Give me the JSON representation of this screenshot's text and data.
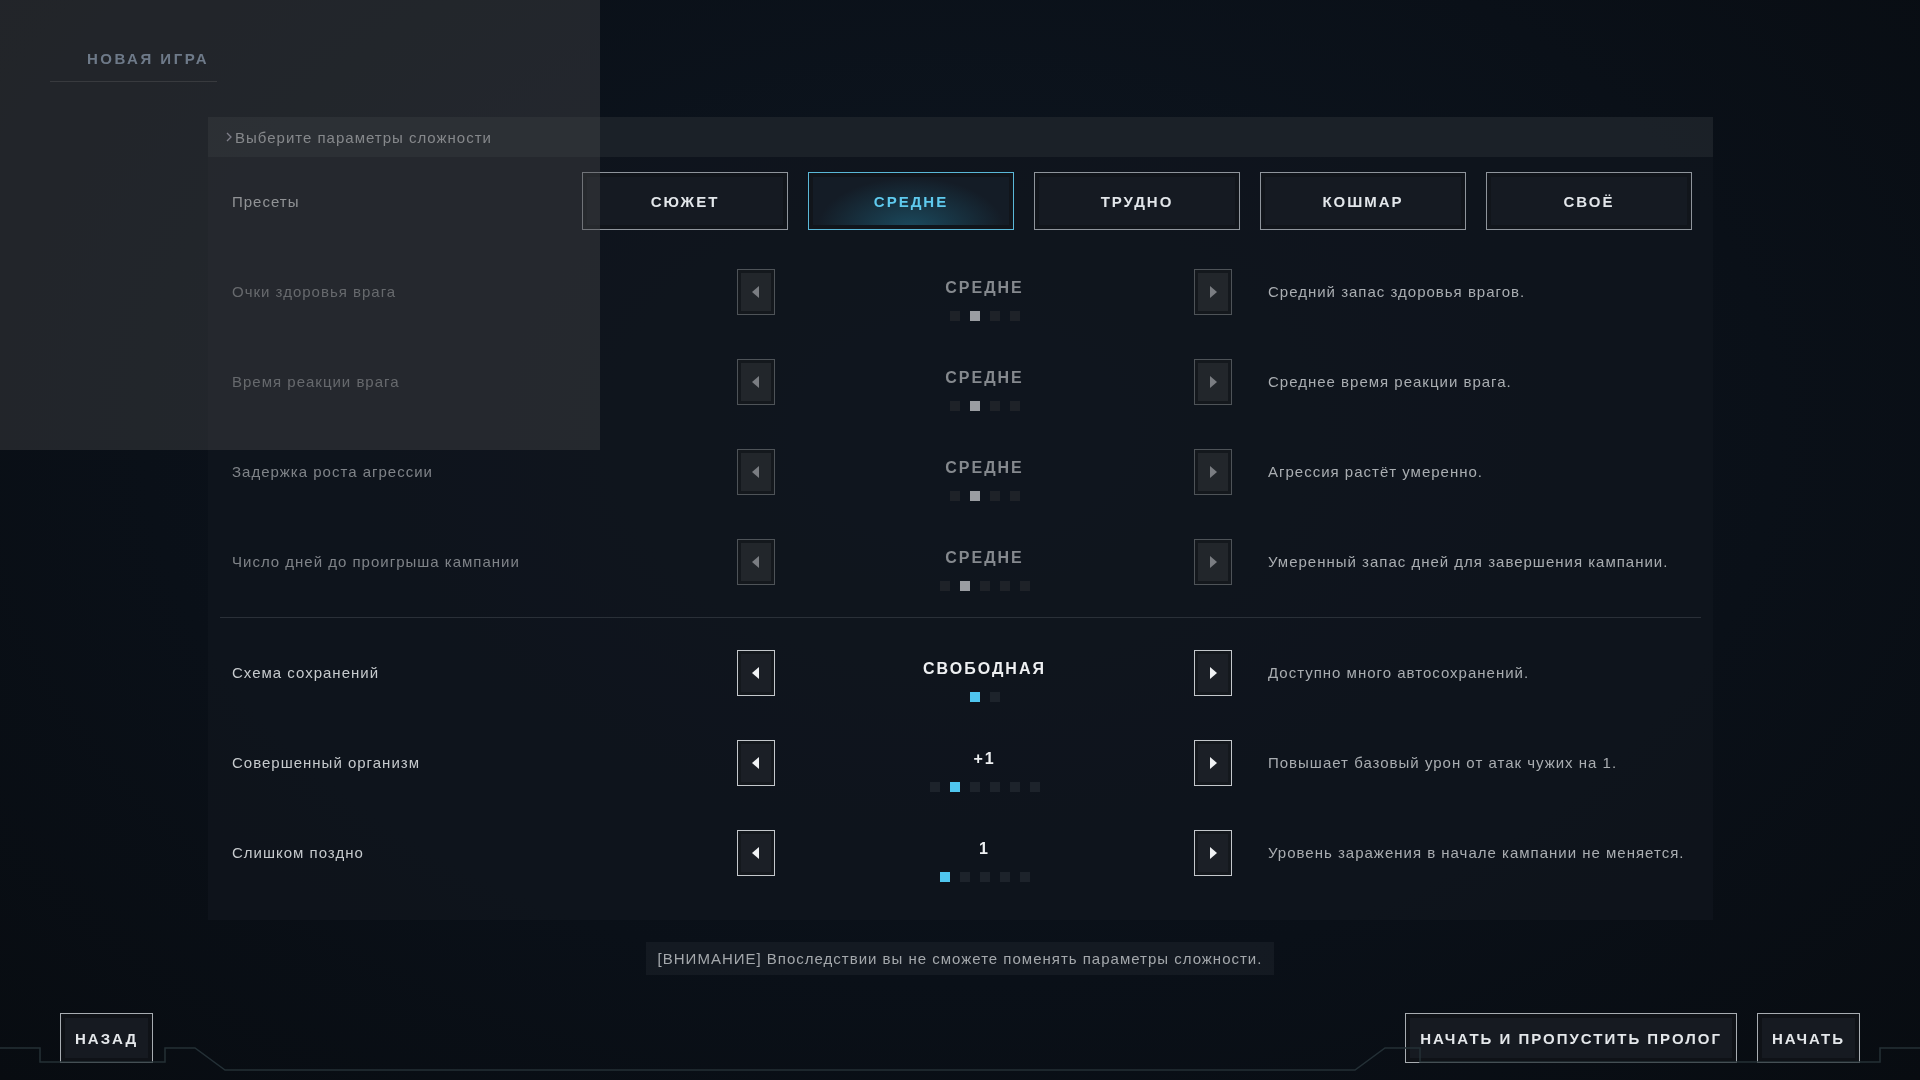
{
  "title": "НОВАЯ ИГРА",
  "section_header": "Выберите параметры сложности",
  "presets": {
    "label": "Пресеты",
    "options": [
      {
        "label": "СЮЖЕТ",
        "selected": false
      },
      {
        "label": "СРЕДНЕ",
        "selected": true
      },
      {
        "label": "ТРУДНО",
        "selected": false
      },
      {
        "label": "КОШМАР",
        "selected": false
      },
      {
        "label": "СВОЁ",
        "selected": false
      }
    ]
  },
  "setting_groups": [
    {
      "settings": [
        {
          "label": "Очки здоровья врага",
          "value": "СРЕДНЕ",
          "description": "Средний запас здоровья врагов.",
          "disabled": true,
          "pips": [
            {
              "selected": false
            },
            {
              "selected": true
            },
            {
              "selected": false
            },
            {
              "selected": false
            }
          ]
        },
        {
          "label": "Время реакции врага",
          "value": "СРЕДНЕ",
          "description": "Среднее время реакции врага.",
          "disabled": true,
          "pips": [
            {
              "selected": false
            },
            {
              "selected": true
            },
            {
              "selected": false
            },
            {
              "selected": false
            }
          ]
        },
        {
          "label": "Задержка роста агрессии",
          "value": "СРЕДНЕ",
          "description": "Агрессия растёт умеренно.",
          "disabled": true,
          "pips": [
            {
              "selected": false
            },
            {
              "selected": true
            },
            {
              "selected": false
            },
            {
              "selected": false
            }
          ]
        },
        {
          "label": "Число дней до проигрыша кампании",
          "value": "СРЕДНЕ",
          "description": "Умеренный запас дней для завершения кампании.",
          "disabled": true,
          "pips": [
            {
              "selected": false
            },
            {
              "selected": true
            },
            {
              "selected": false
            },
            {
              "selected": false
            },
            {
              "selected": false
            }
          ]
        }
      ]
    },
    {
      "settings": [
        {
          "label": "Схема сохранений",
          "value": "СВОБОДНАЯ",
          "description": "Доступно много автосохранений.",
          "disabled": false,
          "pips": [
            {
              "selected": true
            },
            {
              "selected": false
            }
          ]
        },
        {
          "label": "Совершенный организм",
          "value": "+1",
          "description": "Повышает базовый урон от атак чужих на 1.",
          "disabled": false,
          "pips": [
            {
              "selected": false
            },
            {
              "selected": true
            },
            {
              "selected": false
            },
            {
              "selected": false
            },
            {
              "selected": false
            },
            {
              "selected": false
            }
          ]
        },
        {
          "label": "Слишком поздно",
          "value": "1",
          "description": "Уровень заражения в начале кампании не меняется.",
          "disabled": false,
          "pips": [
            {
              "selected": true
            },
            {
              "selected": false
            },
            {
              "selected": false
            },
            {
              "selected": false
            },
            {
              "selected": false
            }
          ]
        }
      ]
    }
  ],
  "warning": "[ВНИМАНИЕ] Впоследствии вы не сможете поменять параметры сложности.",
  "buttons": {
    "back": "НАЗАД",
    "skip_prologue": "НАЧАТЬ И ПРОПУСТИТЬ ПРОЛОГ",
    "start": "НАЧАТЬ"
  }
}
